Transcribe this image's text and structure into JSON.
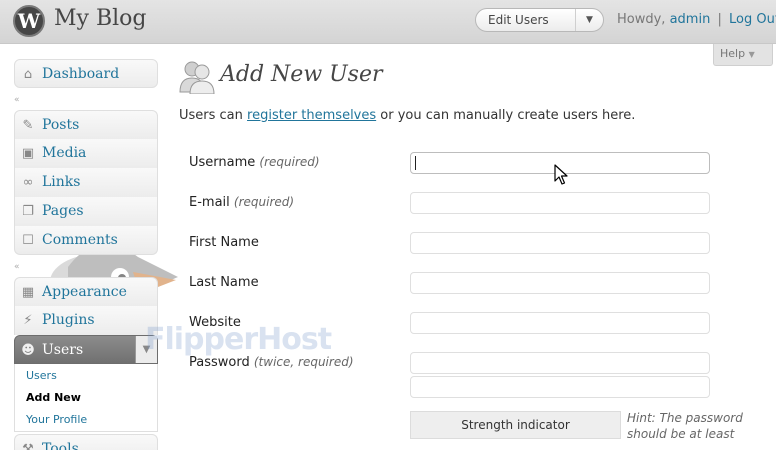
{
  "header": {
    "site_title": "My Blog",
    "favorite_actions": {
      "selected": "Edit Users"
    },
    "greeting": "Howdy,",
    "username": "admin",
    "separator": "|",
    "logout": "Log Out"
  },
  "help_tab": "Help",
  "sidebar": {
    "dashboard": "Dashboard",
    "posts": "Posts",
    "media": "Media",
    "links": "Links",
    "pages": "Pages",
    "comments": "Comments",
    "appearance": "Appearance",
    "plugins": "Plugins",
    "users": "Users",
    "tools": "Tools",
    "users_submenu": {
      "users": "Users",
      "add_new": "Add New",
      "your_profile": "Your Profile"
    }
  },
  "main": {
    "title": "Add New User",
    "intro_before": "Users can ",
    "intro_link": "register themselves",
    "intro_after": " or you can manually create users here.",
    "fields": {
      "username": {
        "label": "Username",
        "note": "(required)",
        "value": ""
      },
      "email": {
        "label": "E-mail",
        "note": "(required)",
        "value": ""
      },
      "first_name": {
        "label": "First Name",
        "value": ""
      },
      "last_name": {
        "label": "Last Name",
        "value": ""
      },
      "website": {
        "label": "Website",
        "value": ""
      },
      "password": {
        "label": "Password",
        "note": "(twice, required)",
        "value": ""
      }
    },
    "strength_indicator": "Strength indicator",
    "hint": "Hint: The password should be at least"
  },
  "watermark": "FlipperHost",
  "icons": {
    "logo": "wordpress-logo-icon",
    "dashboard": "home-icon",
    "posts": "pushpin-icon",
    "media": "media-icon",
    "links": "chain-link-icon",
    "pages": "pages-icon",
    "comments": "speech-bubble-icon",
    "appearance": "layout-icon",
    "plugins": "plug-icon",
    "users": "users-icon",
    "tools": "wrench-icon"
  },
  "colors": {
    "link": "#21759b",
    "active_menu": "#7d7d7d"
  }
}
